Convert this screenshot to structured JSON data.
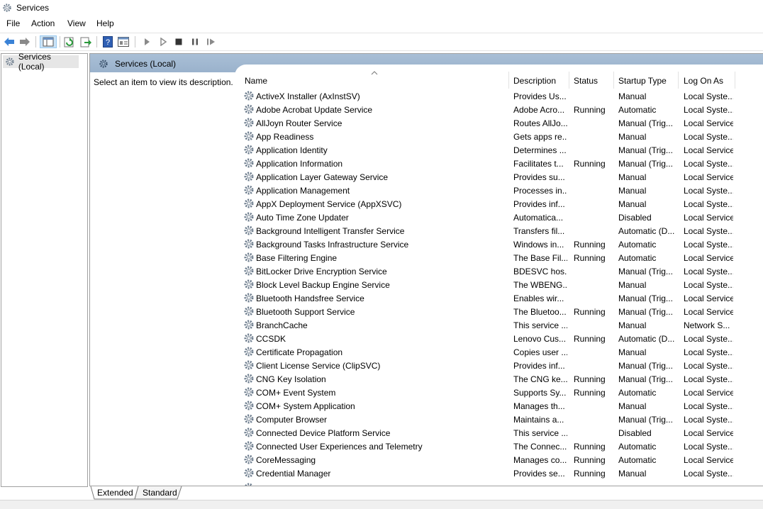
{
  "window": {
    "title": "Services"
  },
  "menu": [
    "File",
    "Action",
    "View",
    "Help"
  ],
  "tree": {
    "root_label": "Services (Local)"
  },
  "panel": {
    "header_title": "Services (Local)",
    "description_hint": "Select an item to view its description."
  },
  "table": {
    "columns": [
      "Name",
      "Description",
      "Status",
      "Startup Type",
      "Log On As"
    ],
    "rows": [
      [
        "ActiveX Installer (AxInstSV)",
        "Provides Us...",
        "",
        "Manual",
        "Local Syste..."
      ],
      [
        "Adobe Acrobat Update Service",
        "Adobe Acro...",
        "Running",
        "Automatic",
        "Local Syste..."
      ],
      [
        "AllJoyn Router Service",
        "Routes AllJo...",
        "",
        "Manual (Trig...",
        "Local Service"
      ],
      [
        "App Readiness",
        "Gets apps re...",
        "",
        "Manual",
        "Local Syste..."
      ],
      [
        "Application Identity",
        "Determines ...",
        "",
        "Manual (Trig...",
        "Local Service"
      ],
      [
        "Application Information",
        "Facilitates t...",
        "Running",
        "Manual (Trig...",
        "Local Syste..."
      ],
      [
        "Application Layer Gateway Service",
        "Provides su...",
        "",
        "Manual",
        "Local Service"
      ],
      [
        "Application Management",
        "Processes in...",
        "",
        "Manual",
        "Local Syste..."
      ],
      [
        "AppX Deployment Service (AppXSVC)",
        "Provides inf...",
        "",
        "Manual",
        "Local Syste..."
      ],
      [
        "Auto Time Zone Updater",
        "Automatica...",
        "",
        "Disabled",
        "Local Service"
      ],
      [
        "Background Intelligent Transfer Service",
        "Transfers fil...",
        "",
        "Automatic (D...",
        "Local Syste..."
      ],
      [
        "Background Tasks Infrastructure Service",
        "Windows in...",
        "Running",
        "Automatic",
        "Local Syste..."
      ],
      [
        "Base Filtering Engine",
        "The Base Fil...",
        "Running",
        "Automatic",
        "Local Service"
      ],
      [
        "BitLocker Drive Encryption Service",
        "BDESVC hos...",
        "",
        "Manual (Trig...",
        "Local Syste..."
      ],
      [
        "Block Level Backup Engine Service",
        "The WBENG...",
        "",
        "Manual",
        "Local Syste..."
      ],
      [
        "Bluetooth Handsfree Service",
        "Enables wir...",
        "",
        "Manual (Trig...",
        "Local Service"
      ],
      [
        "Bluetooth Support Service",
        "The Bluetoo...",
        "Running",
        "Manual (Trig...",
        "Local Service"
      ],
      [
        "BranchCache",
        "This service ...",
        "",
        "Manual",
        "Network S..."
      ],
      [
        "CCSDK",
        "Lenovo Cus...",
        "Running",
        "Automatic (D...",
        "Local Syste..."
      ],
      [
        "Certificate Propagation",
        "Copies user ...",
        "",
        "Manual",
        "Local Syste..."
      ],
      [
        "Client License Service (ClipSVC)",
        "Provides inf...",
        "",
        "Manual (Trig...",
        "Local Syste..."
      ],
      [
        "CNG Key Isolation",
        "The CNG ke...",
        "Running",
        "Manual (Trig...",
        "Local Syste..."
      ],
      [
        "COM+ Event System",
        "Supports Sy...",
        "Running",
        "Automatic",
        "Local Service"
      ],
      [
        "COM+ System Application",
        "Manages th...",
        "",
        "Manual",
        "Local Syste..."
      ],
      [
        "Computer Browser",
        "Maintains a...",
        "",
        "Manual (Trig...",
        "Local Syste..."
      ],
      [
        "Connected Device Platform Service",
        "This service ...",
        "",
        "Disabled",
        "Local Service"
      ],
      [
        "Connected User Experiences and Telemetry",
        "The Connec...",
        "Running",
        "Automatic",
        "Local Syste..."
      ],
      [
        "CoreMessaging",
        "Manages co...",
        "Running",
        "Automatic",
        "Local Service"
      ],
      [
        "Credential Manager",
        "Provides se...",
        "Running",
        "Manual",
        "Local Syste..."
      ]
    ]
  },
  "tabs": [
    "Extended",
    "Standard"
  ],
  "colors": {
    "header_band": "#9ab2cc",
    "tree_selected": "#e6e6e6",
    "border": "#a0a0a0"
  },
  "icons": {
    "service": "gear-icon",
    "window": "gear-icon"
  }
}
